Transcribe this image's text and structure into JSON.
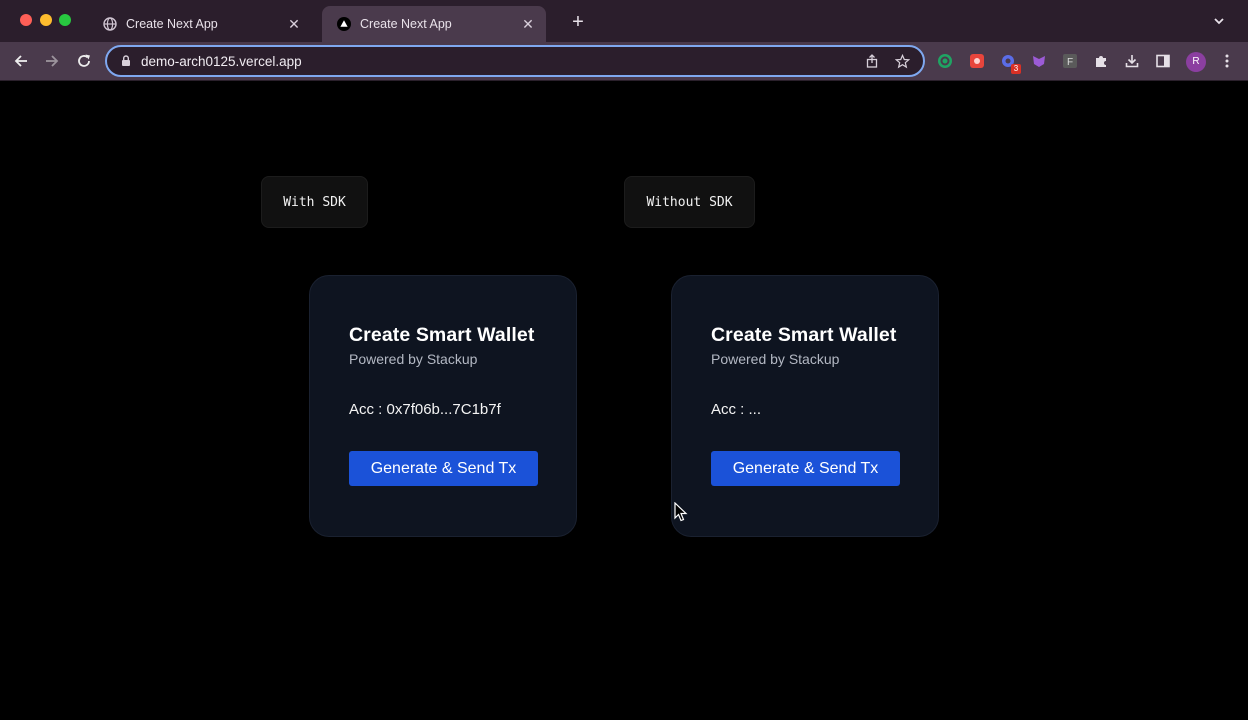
{
  "browser": {
    "tabs": [
      {
        "title": "Create Next App",
        "active": false
      },
      {
        "title": "Create Next App",
        "active": true
      }
    ],
    "url": "demo-arch0125.vercel.app",
    "extension_badge": "3",
    "profile_initial": "R"
  },
  "page": {
    "labels": {
      "with_sdk": "With SDK",
      "without_sdk": "Without SDK"
    },
    "cards": [
      {
        "title": "Create Smart Wallet",
        "subtitle": "Powered by Stackup",
        "account": "Acc : 0x7f06b...7C1b7f",
        "button": "Generate & Send Tx"
      },
      {
        "title": "Create Smart Wallet",
        "subtitle": "Powered by Stackup",
        "account": "Acc : ...",
        "button": "Generate & Send Tx"
      }
    ]
  },
  "colors": {
    "accent_button": "#1b52d8",
    "card_background": "#0e1420",
    "page_background": "#000000"
  },
  "icons": [
    "globe-icon",
    "vercel-triangle-icon",
    "close-icon",
    "plus-icon",
    "chevron-down-icon",
    "back-arrow-icon",
    "forward-arrow-icon",
    "reload-icon",
    "lock-icon",
    "share-icon",
    "star-icon",
    "puzzle-icon",
    "download-icon",
    "sidebar-icon",
    "kebab-menu-icon"
  ]
}
